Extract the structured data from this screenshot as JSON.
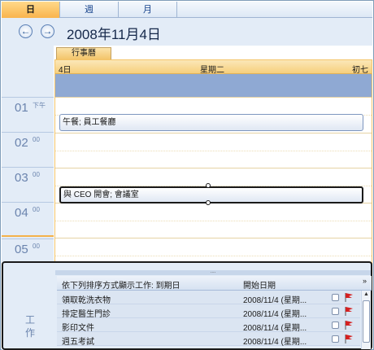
{
  "tabs": [
    {
      "label": "日",
      "active": true
    },
    {
      "label": "週",
      "active": false
    },
    {
      "label": "月",
      "active": false
    }
  ],
  "nav": {
    "prev_icon": "arrow-left-circle-icon",
    "next_icon": "arrow-right-circle-icon",
    "date_title": "2008年11月4日"
  },
  "calendar": {
    "tab_label": "行事曆",
    "day_left": "4日",
    "day_mid": "星期二",
    "day_right": "初七"
  },
  "times": [
    {
      "hour": "01",
      "suffix": "下午"
    },
    {
      "hour": "02",
      "suffix": "00"
    },
    {
      "hour": "03",
      "suffix": "00"
    },
    {
      "hour": "04",
      "suffix": "00"
    },
    {
      "hour": "05",
      "suffix": "00"
    }
  ],
  "appointments": [
    {
      "label": "午餐; 員工餐廳"
    },
    {
      "label": "與 CEO 開會; 會議室"
    }
  ],
  "tasks": {
    "pane_label": "工作",
    "splitter": "....",
    "header_name": "依下列排序方式顯示工作: 到期日",
    "header_date": "開始日期",
    "header_toggle": "»",
    "rows": [
      {
        "name": "領取乾洗衣物",
        "date": "2008/11/4 (星期..."
      },
      {
        "name": "排定醫生門診",
        "date": "2008/11/4 (星期..."
      },
      {
        "name": "影印文件",
        "date": "2008/11/4 (星期..."
      },
      {
        "name": "週五考試",
        "date": "2008/11/4 (星期..."
      }
    ]
  },
  "colors": {
    "accent": "#f9b44d",
    "nav_bg": "#e3ecf7",
    "allday_band": "#8fa9d3",
    "flag": "#d42020"
  }
}
